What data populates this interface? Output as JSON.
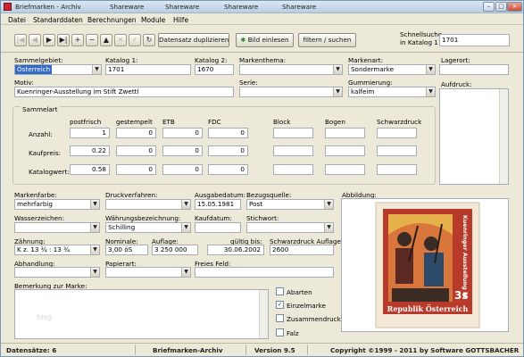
{
  "titlebar": {
    "title": "Briefmarken - Archiv",
    "shareware": [
      "Shareware",
      "Shareware",
      "Shareware",
      "Shareware"
    ],
    "minimize": "–",
    "maximize": "□",
    "close": "×"
  },
  "menu": [
    "Datei",
    "Standarddaten",
    "Berechnungen",
    "Module",
    "Hilfe"
  ],
  "toolbar": {
    "nav": [
      "|◀",
      "◀",
      "▶",
      "▶|",
      "+",
      "−",
      "▲",
      "✕",
      "✓",
      "↻"
    ],
    "duplicate": "Datensatz duplizieren",
    "read_image": "Bild einlesen",
    "filter": "filtern / suchen",
    "quicksearch_label_1": "Schnellsuche",
    "quicksearch_label_2": "in Katalog 1",
    "quicksearch_value": "1701"
  },
  "fields": {
    "sammelgebiet_label": "Sammelgebiet:",
    "sammelgebiet": "Österreich",
    "katalog1_label": "Katalog 1:",
    "katalog1": "1701",
    "katalog2_label": "Katalog 2:",
    "katalog2": "1670",
    "markenthema_label": "Markenthema:",
    "markenthema": "",
    "markenart_label": "Markenart:",
    "markenart": "Sondermarke",
    "lagerort_label": "Lagerort:",
    "lagerort": "",
    "motiv_label": "Motiv:",
    "motiv": "Kuenringer-Ausstellung im Stift Zwettl",
    "serie_label": "Serie:",
    "serie": "",
    "gummierung_label": "Gummierung:",
    "gummierung": "kalfeim",
    "aufdruck_label": "Aufdruck:"
  },
  "sammelart": {
    "title": "Sammelart",
    "columns": [
      "postfrisch",
      "gestempelt",
      "ETB",
      "FDC",
      "Block",
      "Bogen",
      "Schwarzdruck"
    ],
    "rows": [
      {
        "label": "Anzahl:",
        "values": [
          "1",
          "0",
          "0",
          "0",
          "",
          "",
          ""
        ]
      },
      {
        "label": "Kaufpreis:",
        "values": [
          "0.22",
          "0",
          "0",
          "0",
          "",
          "",
          ""
        ]
      },
      {
        "label": "Katalogwert:",
        "values": [
          "0.58",
          "0",
          "0",
          "0",
          "",
          "",
          ""
        ]
      }
    ]
  },
  "details": {
    "markenfarbe_label": "Markenfarbe:",
    "markenfarbe": "mehrfarbig",
    "druckverfahren_label": "Druckverfahren:",
    "druckverfahren": "",
    "ausgabedatum_label": "Ausgabedatum:",
    "ausgabedatum": "15.05.1981",
    "bezugsquelle_label": "Bezugsquelle:",
    "bezugsquelle": "Post",
    "wasserzeichen_label": "Wasserzeichen:",
    "wasserzeichen": "",
    "waehrung_label": "Währungsbezeichnung:",
    "waehrung": "Schilling",
    "kaufdatum_label": "Kaufdatum:",
    "kaufdatum": "",
    "stichwort_label": "Stichwort:",
    "stichwort": "",
    "zaehnung_label": "Zähnung:",
    "zaehnung": "K z. 13 ¾ : 13 ¾",
    "nominale_label": "Nominale:",
    "nominale": "3,00 öS",
    "auflage_label": "Auflage:",
    "auflage": "3 250 000",
    "gueltig_label": "gültig bis:",
    "gueltig": "30.06.2002",
    "schwarzdruck_label": "Schwarzdruck Auflage:",
    "schwarzdruck": "2600",
    "abhandlung_label": "Abhandlung:",
    "abhandlung": "",
    "papierart_label": "Papierart:",
    "papierart": "",
    "freies_label": "Freies Feld:",
    "freies": "",
    "bemerkung_label": "Bemerkung zur Marke:",
    "bemerkung_watermark": "blog",
    "abbildung_label": "Abbildung:"
  },
  "checkboxes": [
    {
      "label": "Abarten",
      "checked": false
    },
    {
      "label": "Einzelmarke",
      "checked": true
    },
    {
      "label": "Zusammendruck",
      "checked": false
    },
    {
      "label": "Falz",
      "checked": false
    }
  ],
  "stamp": {
    "side_text": "Kuenringer Ausstellung im Stift Zwettl",
    "denomination": "3s",
    "country": "Republik Österreich",
    "colors": {
      "frame": "#b83a2a",
      "sky": "#e6b04a",
      "dark": "#3a2b24",
      "paper": "#f3e9d6"
    }
  },
  "status": {
    "records": "Datensätze: 6",
    "app": "Briefmarken-Archiv",
    "version": "Version 9.5",
    "copyright": "Copyright ©1999 - 2011 by Software GOTTSBACHER"
  }
}
